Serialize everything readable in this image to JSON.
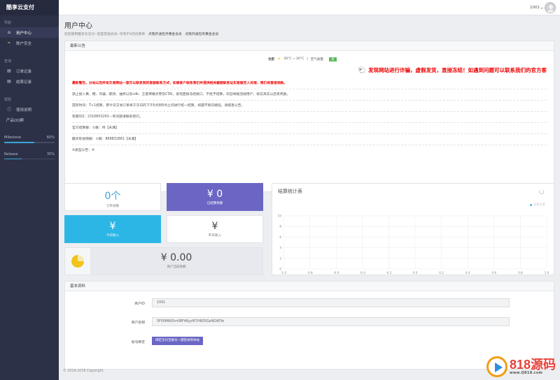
{
  "sidebar": {
    "brand": "酷享云支付",
    "sections": [
      {
        "head": "导航",
        "items": [
          {
            "label": "用户中心",
            "icon": "home-icon"
          },
          {
            "label": "账户安全",
            "icon": "leaf-icon"
          }
        ]
      },
      {
        "head": "查询",
        "items": [
          {
            "label": "订单记录",
            "icon": "list-icon"
          },
          {
            "label": "结算记录",
            "icon": "list-icon"
          }
        ]
      },
      {
        "head": "帮助",
        "items": [
          {
            "label": "使用说明",
            "icon": "info-icon"
          }
        ]
      }
    ],
    "qq_group": "产品QQ群",
    "progress": [
      {
        "label": "Milestone",
        "percent": "60%",
        "value": 60
      },
      {
        "label": "Release",
        "percent": "35%",
        "value": 35
      }
    ]
  },
  "topbar": {
    "user_id": "1001",
    "caret": "▾"
  },
  "page": {
    "title": "用户中心",
    "subtitle": "欢迎使用酷享云支付--您是普通会员--享有3%的优惠率",
    "link1": "点我开通包月黄金会员",
    "link2": "点我开通包年黄金会员"
  },
  "notice": {
    "title": "最新公告",
    "weather_city": "合肥",
    "weather_temp": "30°C ~ 20°C",
    "weather_air": "空气质量：",
    "air_badge": "良",
    "headline": "发现网站进行诈骗，虚假发货，直接冻结！如遇到问题可以联系我们的官方客",
    "lines": [
      {
        "text": "最新警告，分站以及所有交易网站一直可以联系到的客服联系方式，如果客户联系我们并提供相关截图联系证实客服无人处理，我们将直接退款。",
        "type": "warn"
      },
      {
        "text": "禁止接入黄、赌、诈骗、期货、抽奖以及cdk、王者荣耀点券及CDK，发现直接冻结接口，不给予结算，欢迎举报违规用户，核实真实以后有奖励。",
        "type": "normal"
      },
      {
        "text": "提现时间：T+1结算，即今日交易订单将于次日的下午6点到8点之间进行统一结算。如遇节假日顺延，请留意公告。",
        "type": "normal"
      },
      {
        "text": "客服QQ：2316803263---有问题请联系我们。",
        "type": "normal"
      },
      {
        "text": "官方结算群：①群：待【未满】",
        "type": "normal"
      },
      {
        "text": "酷享影视频群：①群：868832881【未满】",
        "type": "normal"
      },
      {
        "text": "※类型公告：※",
        "type": "normal"
      }
    ]
  },
  "stats": {
    "orders": {
      "value": "0个",
      "label": "订单总数"
    },
    "settled": {
      "value": "¥ 0",
      "label": "已结算余额"
    },
    "today": {
      "value": "¥",
      "label": "今日收入"
    },
    "yesterday": {
      "value": "¥",
      "label": "昨日收入"
    },
    "balance": {
      "value": "¥ 0.00",
      "label": "商户当前余额"
    }
  },
  "chart_data": {
    "type": "line",
    "title": "结算统计表",
    "legend": "结算金额",
    "legend_position": "top-right",
    "x": [
      -1.0,
      -0.8,
      -0.6,
      -0.4,
      -0.2,
      0.0,
      0.2,
      0.4,
      0.6,
      0.8,
      1.0
    ],
    "x_ticks": [
      "-1.0",
      "-0.8",
      "-0.6",
      "-0.4",
      "-0.2",
      "0.0",
      "0.2",
      "0.4",
      "0.6",
      "0.8",
      "1.0"
    ],
    "y_ticks": [
      "10",
      "8",
      "6",
      "4",
      "2",
      "0"
    ],
    "ylim": [
      0,
      10
    ],
    "xlim": [
      -1,
      1
    ],
    "series": [
      {
        "name": "结算金额",
        "values": []
      }
    ],
    "grid": true,
    "colors": {
      "series": "#49b6e8",
      "grid": "#eeeeee"
    }
  },
  "info": {
    "title": "基本资料",
    "merchant_id_label": "商户ID",
    "merchant_id": "1001",
    "key_label": "商户密钥",
    "key": "5F00M665m08F4Kyyf67H805GaNG4EYe",
    "bind_label": "账号绑定",
    "bind_button": "绑定支付宝账号一键登录到本站"
  },
  "footer": "© 2016-2018 Copyright.",
  "watermark": {
    "big": "818源码",
    "small": "www.Q818.com"
  },
  "colors": {
    "sidebar": "#2c3148",
    "purple": "#6b66c4",
    "cyan": "#2cb6e6",
    "alert": "#e00000"
  }
}
